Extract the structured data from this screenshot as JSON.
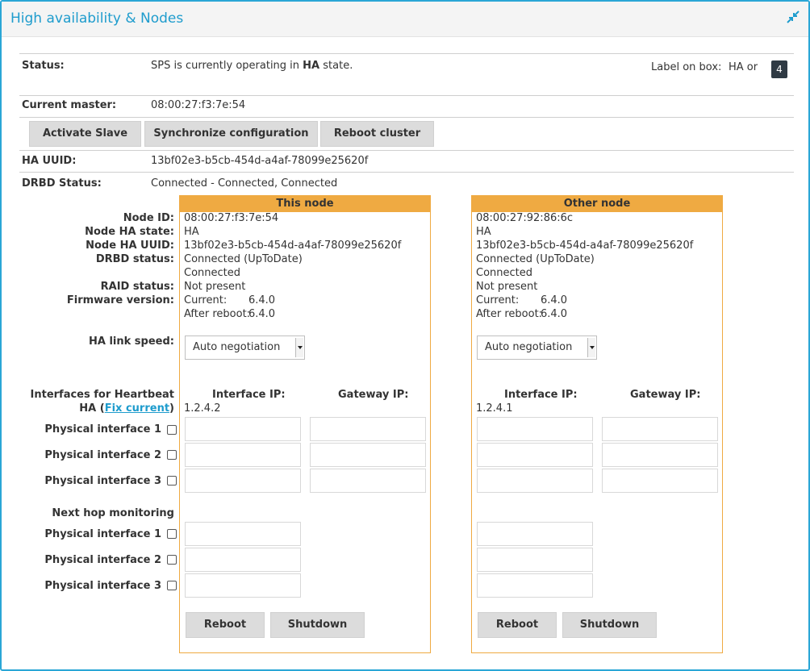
{
  "panel": {
    "title": "High availability & Nodes",
    "collapse_icon": "collapse-arrows-icon",
    "accent": "#2aa6d6"
  },
  "status": {
    "label": "Status:",
    "text_prefix": "SPS is currently operating in",
    "state": "HA",
    "text_suffix": "state.",
    "box_label": "Label on box:",
    "box_value": "HA or",
    "box_badge": "4"
  },
  "current_master": {
    "label": "Current master:",
    "value": "08:00:27:f3:7e:54"
  },
  "actions": {
    "activate_slave": "Activate Slave",
    "sync_config": "Synchronize configuration",
    "reboot_cluster": "Reboot cluster"
  },
  "ha_uuid": {
    "label": "HA UUID:",
    "value": "13bf02e3-b5cb-454d-a4af-78099e25620f"
  },
  "drbd": {
    "label": "DRBD Status:",
    "value": "Connected - Connected, Connected"
  },
  "labels": {
    "node_id": "Node ID:",
    "node_ha_state": "Node HA state:",
    "node_ha_uuid": "Node HA UUID:",
    "drbd_status": "DRBD status:",
    "raid_status": "RAID status:",
    "firmware_version": "Firmware version:",
    "ha_link_speed": "HA link speed:",
    "heartbeat_line1": "Interfaces for Heartbeat",
    "heartbeat_ha": "HA (",
    "fix_current": "Fix current",
    "heartbeat_close": ")",
    "phys1": "Physical interface 1",
    "phys2": "Physical interface 2",
    "phys3": "Physical interface 3",
    "next_hop": "Next hop monitoring",
    "interface_ip": "Interface IP:",
    "gateway_ip": "Gateway IP:"
  },
  "this_node": {
    "header": "This node",
    "node_id": "08:00:27:f3:7e:54",
    "ha_state": "HA",
    "ha_uuid": "13bf02e3-b5cb-454d-a4af-78099e25620f",
    "drbd_line1": "Connected (UpToDate)",
    "drbd_line2": "Connected",
    "raid": "Not present",
    "fw_current_label": "Current:",
    "fw_current": "6.4.0",
    "fw_after_label": "After reboot:",
    "fw_after": "6.4.0",
    "link_speed": "Auto negotiation",
    "ha_ip": "1.2.4.2",
    "reboot": "Reboot",
    "shutdown": "Shutdown"
  },
  "other_node": {
    "header": "Other node",
    "node_id": "08:00:27:92:86:6c",
    "ha_state": "HA",
    "ha_uuid": "13bf02e3-b5cb-454d-a4af-78099e25620f",
    "drbd_line1": "Connected (UpToDate)",
    "drbd_line2": "Connected",
    "raid": "Not present",
    "fw_current_label": "Current:",
    "fw_current": "6.4.0",
    "fw_after_label": "After reboot:",
    "fw_after": "6.4.0",
    "link_speed": "Auto negotiation",
    "ha_ip": "1.2.4.1",
    "reboot": "Reboot",
    "shutdown": "Shutdown"
  },
  "colors": {
    "node_header": "#efaa42",
    "title": "#1e9ccd",
    "button": "#dcdcdc"
  }
}
